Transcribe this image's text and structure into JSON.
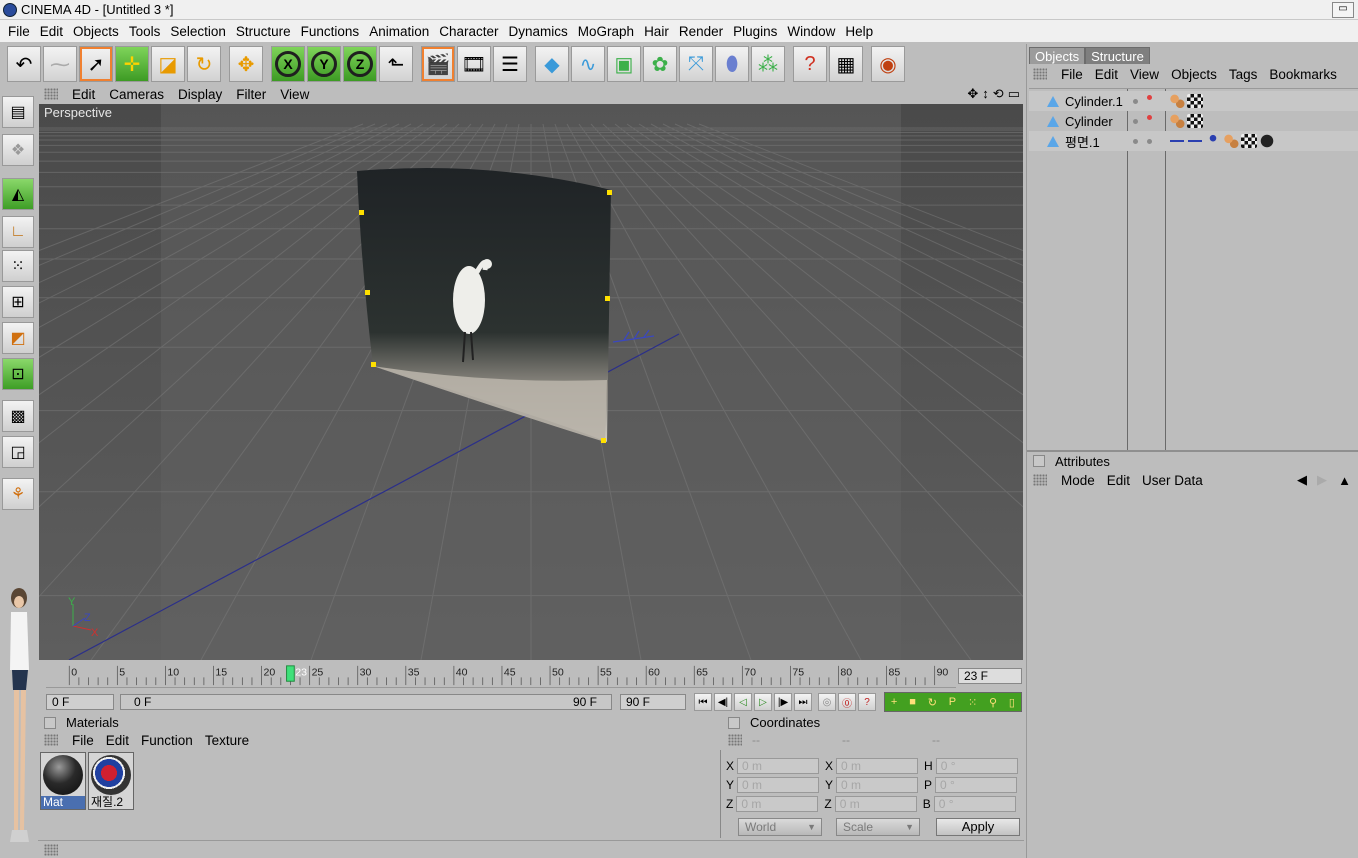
{
  "window": {
    "title": "CINEMA 4D - [Untitled 3 *]",
    "minimize_glyph": "▭"
  },
  "menubar": [
    "File",
    "Edit",
    "Objects",
    "Tools",
    "Selection",
    "Structure",
    "Functions",
    "Animation",
    "Character",
    "Dynamics",
    "MoGraph",
    "Hair",
    "Render",
    "Plugins",
    "Window",
    "Help"
  ],
  "toolbar": {
    "icons": [
      "undo-icon",
      "redo-icon",
      "live-selection-icon",
      "move-icon",
      "scale-icon",
      "rotate-icon",
      "move-cross-icon",
      "x-axis-icon",
      "y-axis-icon",
      "z-axis-icon",
      "coordinate-system-icon",
      "render-view-icon",
      "render-picture-viewer-icon",
      "render-settings-icon",
      "cube-icon",
      "spline-icon",
      "nurbs-icon",
      "array-icon",
      "deformer-icon",
      "scene-icon",
      "environment-icon",
      "help-icon",
      "layout-icon",
      "web-icon"
    ],
    "axis_labels": [
      "X",
      "Y",
      "Z"
    ]
  },
  "lefttools": [
    "texture-mode-icon",
    "sculpt-icon",
    "model-mode-icon",
    "object-axis-icon",
    "points-mode-icon",
    "edges-mode-icon",
    "polygons-mode-icon",
    "uv-points-icon",
    "checker-icon",
    "uv-polygons-icon",
    "paint-icon"
  ],
  "viewport": {
    "menu": [
      "Edit",
      "Cameras",
      "Display",
      "Filter",
      "View"
    ],
    "label": "Perspective",
    "nav_icons": [
      "✥",
      "↕",
      "⟲",
      "▭"
    ],
    "axis_labels": {
      "x": "X",
      "y": "Y",
      "z": "Z"
    }
  },
  "timeline": {
    "ticks": [
      "0",
      "5",
      "10",
      "15",
      "20",
      "25",
      "30",
      "35",
      "40",
      "45",
      "50",
      "55",
      "60",
      "65",
      "70",
      "75",
      "80",
      "85",
      "90"
    ],
    "max_frame": 90,
    "current_frame": 23,
    "current_label": "23",
    "current_frame_field": "23 F"
  },
  "playbar": {
    "start": "0 F",
    "range_start": "0 F",
    "range_end": "90 F",
    "end": "90 F",
    "buttons": [
      "⏮",
      "◀|",
      "◁",
      "▷",
      "|▶",
      "⏭"
    ],
    "record_buttons": [
      "◎",
      "⓪",
      "?"
    ],
    "key_icons": [
      "+",
      "■",
      "↻",
      "P",
      "⁙",
      "⚲",
      "▯"
    ]
  },
  "materials": {
    "title": "Materials",
    "menu": [
      "File",
      "Edit",
      "Function",
      "Texture"
    ],
    "items": [
      {
        "label": "Mat"
      },
      {
        "label": "재질.2"
      }
    ]
  },
  "coordinates": {
    "title": "Coordinates",
    "headers": [
      "--",
      "--",
      "--"
    ],
    "rows": [
      {
        "a": "X",
        "av": "0 m",
        "b": "X",
        "bv": "0 m",
        "c": "H",
        "cv": "0 °"
      },
      {
        "a": "Y",
        "av": "0 m",
        "b": "Y",
        "bv": "0 m",
        "c": "P",
        "cv": "0 °"
      },
      {
        "a": "Z",
        "av": "0 m",
        "b": "Z",
        "bv": "0 m",
        "c": "B",
        "cv": "0 °"
      }
    ],
    "mode_select": "World",
    "size_select": "Scale",
    "apply_label": "Apply"
  },
  "objects_panel": {
    "tabs": [
      "Objects",
      "Structure"
    ],
    "menu": [
      "File",
      "Edit",
      "View",
      "Objects",
      "Tags",
      "Bookmarks"
    ],
    "rows": [
      {
        "name": "Cylinder.1"
      },
      {
        "name": "Cylinder"
      },
      {
        "name": "평면.1"
      }
    ]
  },
  "attributes_panel": {
    "title": "Attributes",
    "menu": [
      "Mode",
      "Edit",
      "User Data"
    ],
    "nav": [
      "◀",
      "▶",
      "▲"
    ]
  },
  "colors": {
    "viewport_bg": "#5c5c5c",
    "accent_green": "#43a020",
    "object_icon": "#5aa6e8",
    "tab_bg": "#7f7f7f"
  }
}
